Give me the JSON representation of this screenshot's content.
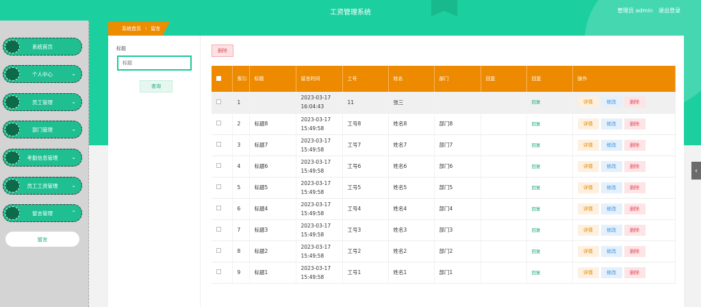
{
  "header": {
    "title": "工资管理系统",
    "user_label": "管理员 admin",
    "logout_label": "退出登录"
  },
  "sidebar": {
    "items": [
      {
        "label": "系统首页",
        "has_chevron": false
      },
      {
        "label": "个人中心",
        "has_chevron": true
      },
      {
        "label": "员工管理",
        "has_chevron": true
      },
      {
        "label": "部门管理",
        "has_chevron": true
      },
      {
        "label": "考勤信息管理",
        "has_chevron": true
      },
      {
        "label": "员工工资管理",
        "has_chevron": true
      },
      {
        "label": "留言管理",
        "has_chevron": true
      }
    ],
    "sub_item": "留言"
  },
  "breadcrumb": {
    "home": "系统首页",
    "separator": "⁝",
    "current": "留言"
  },
  "search": {
    "label": "标题",
    "placeholder": "标题",
    "query_button": "查询"
  },
  "toolbar": {
    "delete_label": "删除"
  },
  "table": {
    "headers": [
      "",
      "索引",
      "标题",
      "留言时间",
      "工号",
      "姓名",
      "部门",
      "回复",
      "回复",
      "操作"
    ],
    "rows": [
      {
        "index": "1",
        "title": "",
        "time": "2023-03-17 16:04:43",
        "emp_no": "11",
        "name": "张三",
        "dept": "",
        "reply": "",
        "reply_link": "回复"
      },
      {
        "index": "2",
        "title": "标题8",
        "time": "2023-03-17 15:49:58",
        "emp_no": "工号8",
        "name": "姓名8",
        "dept": "部门8",
        "reply": "",
        "reply_link": "回复"
      },
      {
        "index": "3",
        "title": "标题7",
        "time": "2023-03-17 15:49:58",
        "emp_no": "工号7",
        "name": "姓名7",
        "dept": "部门7",
        "reply": "",
        "reply_link": "回复"
      },
      {
        "index": "4",
        "title": "标题6",
        "time": "2023-03-17 15:49:58",
        "emp_no": "工号6",
        "name": "姓名6",
        "dept": "部门6",
        "reply": "",
        "reply_link": "回复"
      },
      {
        "index": "5",
        "title": "标题5",
        "time": "2023-03-17 15:49:58",
        "emp_no": "工号5",
        "name": "姓名5",
        "dept": "部门5",
        "reply": "",
        "reply_link": "回复"
      },
      {
        "index": "6",
        "title": "标题4",
        "time": "2023-03-17 15:49:58",
        "emp_no": "工号4",
        "name": "姓名4",
        "dept": "部门4",
        "reply": "",
        "reply_link": "回复"
      },
      {
        "index": "7",
        "title": "标题3",
        "time": "2023-03-17 15:49:58",
        "emp_no": "工号3",
        "name": "姓名3",
        "dept": "部门3",
        "reply": "",
        "reply_link": "回复"
      },
      {
        "index": "8",
        "title": "标题2",
        "time": "2023-03-17 15:49:58",
        "emp_no": "工号2",
        "name": "姓名2",
        "dept": "部门2",
        "reply": "",
        "reply_link": "回复"
      },
      {
        "index": "9",
        "title": "标题1",
        "time": "2023-03-17 15:49:58",
        "emp_no": "工号1",
        "name": "姓名1",
        "dept": "部门1",
        "reply": "",
        "reply_link": "回复"
      }
    ],
    "actions": {
      "detail": "详情",
      "edit": "修改",
      "delete": "删除"
    }
  },
  "colors": {
    "primary": "#1ccf9f",
    "accent": "#ee8a00",
    "sidebar_bg": "#d4d4d4"
  },
  "icons": {
    "chevron": "chevron-down-icon",
    "side_toggle": "chevron-left-icon"
  }
}
